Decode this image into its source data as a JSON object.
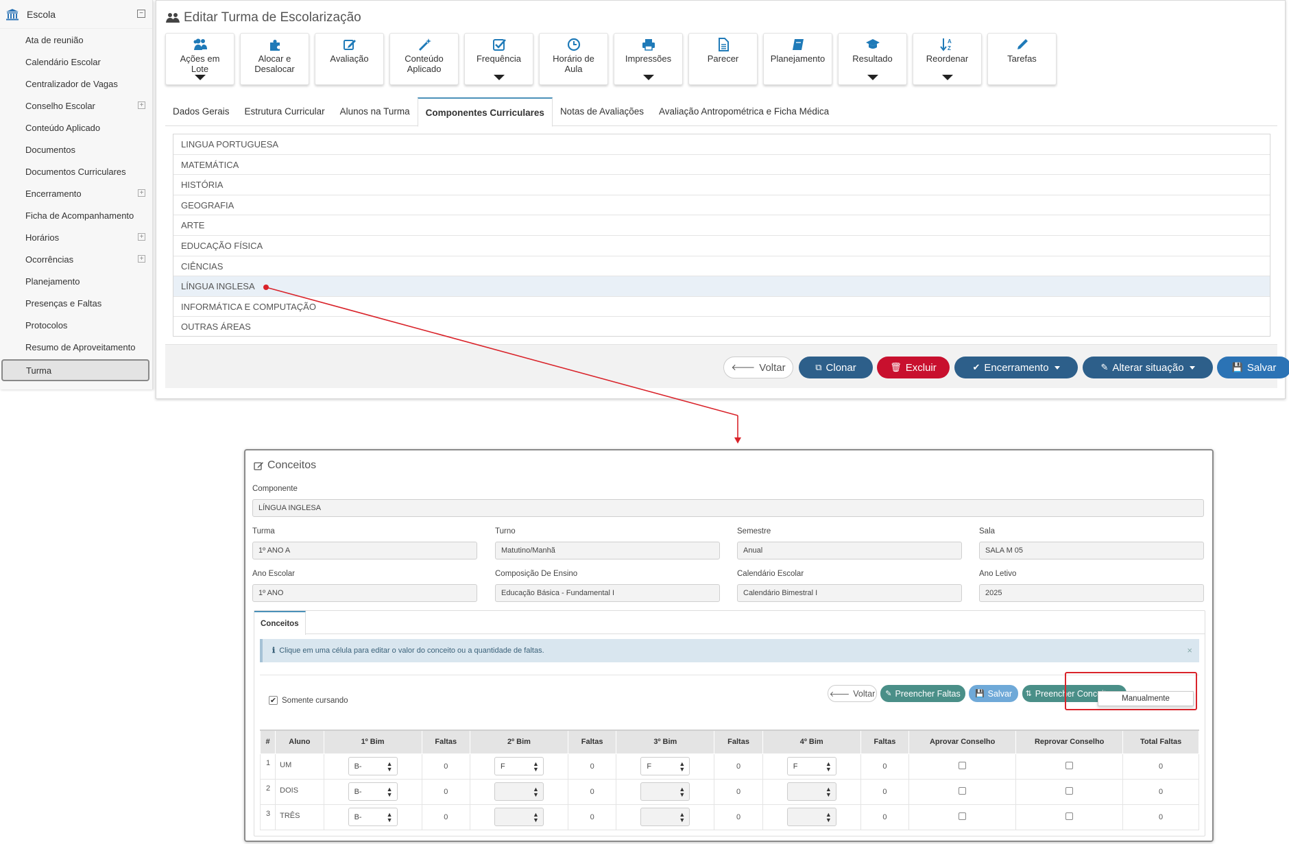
{
  "sidebar": {
    "header": "Escola",
    "items": [
      {
        "label": "Ata de reunião",
        "expandable": false
      },
      {
        "label": "Calendário Escolar",
        "expandable": false
      },
      {
        "label": "Centralizador de Vagas",
        "expandable": false
      },
      {
        "label": "Conselho Escolar",
        "expandable": true
      },
      {
        "label": "Conteúdo Aplicado",
        "expandable": false
      },
      {
        "label": "Documentos",
        "expandable": false
      },
      {
        "label": "Documentos Curriculares",
        "expandable": false
      },
      {
        "label": "Encerramento",
        "expandable": true
      },
      {
        "label": "Ficha de Acompanhamento",
        "expandable": false
      },
      {
        "label": "Horários",
        "expandable": true
      },
      {
        "label": "Ocorrências",
        "expandable": true
      },
      {
        "label": "Planejamento",
        "expandable": false
      },
      {
        "label": "Presenças e Faltas",
        "expandable": false
      },
      {
        "label": "Protocolos",
        "expandable": false
      },
      {
        "label": "Resumo de Aproveitamento",
        "expandable": false
      },
      {
        "label": "Turma",
        "expandable": false,
        "active": true
      }
    ]
  },
  "top": {
    "title": "Editar Turma de Escolarização",
    "toolbar": [
      {
        "label": "Ações em Lote",
        "icon": "users-icon",
        "dropdown": true
      },
      {
        "label": "Alocar e Desalocar",
        "icon": "puzzle-icon",
        "dropdown": false
      },
      {
        "label": "Avaliação",
        "icon": "edit-icon",
        "dropdown": false
      },
      {
        "label": "Conteúdo Aplicado",
        "icon": "magic-wand-icon",
        "dropdown": false
      },
      {
        "label": "Frequência",
        "icon": "check-square-icon",
        "dropdown": true
      },
      {
        "label": "Horário de Aula",
        "icon": "clock-icon",
        "dropdown": false
      },
      {
        "label": "Impressões",
        "icon": "printer-icon",
        "dropdown": true
      },
      {
        "label": "Parecer",
        "icon": "document-icon",
        "dropdown": false
      },
      {
        "label": "Planejamento",
        "icon": "book-icon",
        "dropdown": false
      },
      {
        "label": "Resultado",
        "icon": "graduation-cap-icon",
        "dropdown": true
      },
      {
        "label": "Reordenar",
        "icon": "sort-az-icon",
        "dropdown": true
      },
      {
        "label": "Tarefas",
        "icon": "pencil-icon",
        "dropdown": false
      }
    ],
    "tabs": [
      "Dados Gerais",
      "Estrutura Curricular",
      "Alunos na Turma",
      "Componentes Curriculares",
      "Notas de Avaliações",
      "Avaliação Antropométrica e Ficha Médica"
    ],
    "active_tab": "Componentes Curriculares",
    "components": [
      "LINGUA PORTUGUESA",
      "MATEMÁTICA",
      "HISTÓRIA",
      "GEOGRAFIA",
      "ARTE",
      "EDUCAÇÃO FÍSICA",
      "CIÊNCIAS",
      "LÍNGUA INGLESA",
      "INFORMÁTICA E COMPUTAÇÃO",
      "OUTRAS ÁREAS"
    ],
    "highlighted_component": "LÍNGUA INGLESA",
    "footer": {
      "voltar": "Voltar",
      "clonar": "Clonar",
      "excluir": "Excluir",
      "encerramento": "Encerramento",
      "alterar": "Alterar situação",
      "salvar": "Salvar"
    }
  },
  "bottom": {
    "title": "Conceitos",
    "fields": {
      "componente": {
        "label": "Componente",
        "value": "LÍNGUA INGLESA"
      },
      "turma": {
        "label": "Turma",
        "value": "1º ANO A"
      },
      "turno": {
        "label": "Turno",
        "value": "Matutino/Manhã"
      },
      "semestre": {
        "label": "Semestre",
        "value": "Anual"
      },
      "sala": {
        "label": "Sala",
        "value": "SALA M 05"
      },
      "ano_escolar": {
        "label": "Ano Escolar",
        "value": "1º ANO"
      },
      "composicao": {
        "label": "Composição De Ensino",
        "value": "Educação Básica - Fundamental I"
      },
      "calendario": {
        "label": "Calendário Escolar",
        "value": "Calendário Bimestral I"
      },
      "ano_letivo": {
        "label": "Ano Letivo",
        "value": "2025"
      }
    },
    "tab": "Conceitos",
    "info": "Clique em uma célula para editar o valor do conceito ou a quantidade de faltas.",
    "somente_cursando": "Somente cursando",
    "buttons": {
      "voltar": "Voltar",
      "preencher_faltas": "Preencher Faltas",
      "salvar": "Salvar",
      "preencher_conceitos": "Preencher Conceitos",
      "manualmente": "Manualmente"
    },
    "columns": [
      "#",
      "Aluno",
      "1º Bim",
      "Faltas",
      "2º Bim",
      "Faltas",
      "3º Bim",
      "Faltas",
      "4º Bim",
      "Faltas",
      "Aprovar Conselho",
      "Reprovar Conselho",
      "Total Faltas"
    ],
    "rows": [
      {
        "n": "1",
        "aluno": "UM",
        "b1": "B-",
        "f1": "0",
        "b2": "F",
        "f2": "0",
        "b3": "F",
        "f3": "0",
        "b4": "F",
        "f4": "0",
        "total": "0"
      },
      {
        "n": "2",
        "aluno": "DOIS",
        "b1": "B-",
        "f1": "0",
        "b2": "",
        "f2": "0",
        "b3": "",
        "f3": "0",
        "b4": "",
        "f4": "0",
        "total": "0"
      },
      {
        "n": "3",
        "aluno": "TRÊS",
        "b1": "B-",
        "f1": "0",
        "b2": "",
        "f2": "0",
        "b3": "",
        "f3": "0",
        "b4": "",
        "f4": "0",
        "total": "0"
      }
    ]
  },
  "colors": {
    "blue_dark": "#2d5f8a",
    "red": "#c8102e",
    "blue_btn": "#2b73b5",
    "teal": "#4a8f88",
    "light_blue": "#6fa9d8",
    "annotation_red": "#d9232a"
  }
}
